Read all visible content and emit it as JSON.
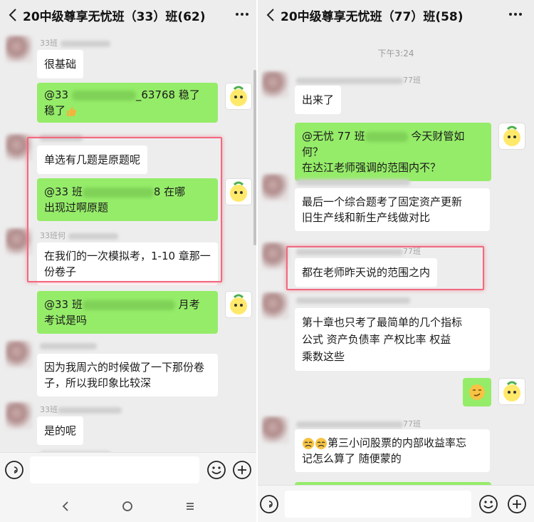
{
  "left": {
    "title": "20中级尊享无忧班（33）班(62)",
    "messages": {
      "m1": {
        "sender": "33班",
        "text": "很基础"
      },
      "m2": {
        "mention": "@33 ",
        "tail1": "_63768 稳了",
        "tail2": "稳了"
      },
      "m3": {
        "text": "单选有几题是原题呢"
      },
      "m4": {
        "mention": "@33 班",
        "tail1": "8 在哪",
        "line2": "出现过啊原题"
      },
      "m5": {
        "sender": "33班何",
        "line1": "在我们的一次模拟考，1-10 章那一",
        "line2": "份卷子"
      },
      "m6": {
        "mention": "@33 班",
        "tail1": " 月考",
        "line2": "考试是吗"
      },
      "m7": {
        "line1": "因为我周六的时候做了一下那份卷",
        "line2": "子，所以我印象比较深"
      },
      "m8": {
        "sender": "33班",
        "text": "是的呢"
      }
    },
    "emoji_names": [
      "thumbs-up-emoji"
    ]
  },
  "right": {
    "title": "20中级尊享无忧班（77）班(58)",
    "time": "下午3:24",
    "messages": {
      "m1": {
        "sender": "77班",
        "text": "出来了"
      },
      "m2": {
        "mention": "@无忧 77 班",
        "tail1": " 今天财管如何？",
        "line2": "在达江老师强调的范围内不？"
      },
      "m3": {
        "line1": "最后一个综合题考了固定资产更新",
        "line2": "旧生产线和新生产线做对比"
      },
      "m4": {
        "sender": "77班",
        "text": "都在老师昨天说的范围之内"
      },
      "m5": {
        "line1": "第十章也只考了最简单的几个指标",
        "line2": "公式  资产负债率  产权比率  权益",
        "line3": "乘数这些"
      },
      "m6": {
        "type": "emoji-only"
      },
      "m7": {
        "sender": "77班",
        "line1": "第三小问股票的内部收益率忘",
        "line2": "记怎么算了   随便蒙的"
      }
    }
  },
  "colors": {
    "incoming_bubble": "#ffffff",
    "outgoing_bubble": "#95ec69",
    "highlight_box": "#f06a7f",
    "background": "#ededed"
  },
  "icons": [
    "back-arrow-icon",
    "more-options-icon",
    "voice-input-icon",
    "emoji-icon",
    "plus-icon",
    "nav-back-icon",
    "nav-home-icon",
    "nav-menu-icon"
  ]
}
